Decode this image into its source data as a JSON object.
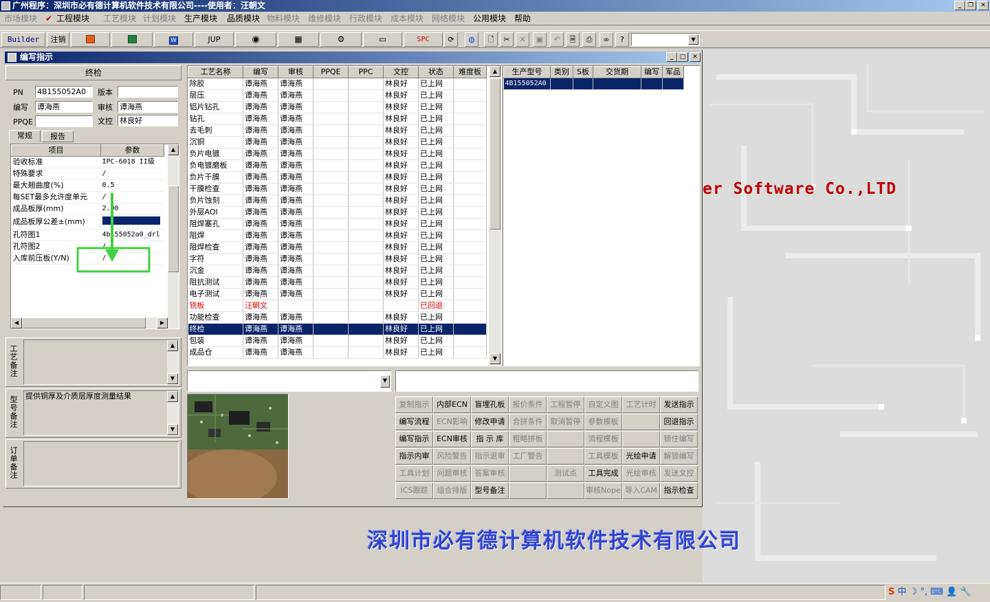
{
  "app": {
    "title": "广州程序：深圳市必有德计算机软件技术有限公司----使用者：汪朝文"
  },
  "menu": [
    {
      "label": "市场模块",
      "enabled": false
    },
    {
      "label": "工程模块",
      "enabled": true,
      "checked": true
    },
    {
      "label": "工艺模块",
      "enabled": false
    },
    {
      "label": "计划模块",
      "enabled": false
    },
    {
      "label": "生产模块",
      "enabled": true
    },
    {
      "label": "品质模块",
      "enabled": true
    },
    {
      "label": "物料模块",
      "enabled": false
    },
    {
      "label": "维修模块",
      "enabled": false
    },
    {
      "label": "行政模块",
      "enabled": false
    },
    {
      "label": "成本模块",
      "enabled": false
    },
    {
      "label": "网络模块",
      "enabled": false
    },
    {
      "label": "公用模块",
      "enabled": true
    },
    {
      "label": "帮助",
      "enabled": true
    }
  ],
  "toolbar": {
    "builder": "Builder",
    "logout": "注销",
    "jup": "JUP",
    "spc": "SPC",
    "combo": ""
  },
  "background": {
    "company_en": "er Software Co.,LTD",
    "company_cn": "深圳市必有德计算机软件技术有限公司"
  },
  "window": {
    "title": "编写指示"
  },
  "left": {
    "process": "终检",
    "pn_label": "PN",
    "pn": "4B155052A0",
    "version_label": "版本",
    "version": "",
    "writer_label": "编写",
    "writer": "谭海燕",
    "review_label": "审核",
    "review": "谭海燕",
    "ppqe_label": "PPQE",
    "ppqe": "",
    "doc_label": "文控",
    "doc": "林良好",
    "tabs": [
      "常规",
      "报告"
    ],
    "params_headers": [
      "项目",
      "参数"
    ],
    "params": [
      {
        "item": "验收标准",
        "value": "IPC-6018 II级"
      },
      {
        "item": "特殊要求",
        "value": "/"
      },
      {
        "item": "最大翘曲度(%)",
        "value": "0.5"
      },
      {
        "item": "每SET最多允许度单元",
        "value": "/"
      },
      {
        "item": "成品板厚(mm)",
        "value": "2.00"
      },
      {
        "item": "成品板厚公差±(mm)",
        "value": ""
      },
      {
        "item": "孔符图1",
        "value": "4b155052a0_drl"
      },
      {
        "item": "孔符图2",
        "value": "/"
      },
      {
        "item": "入库前压板(Y/N)",
        "value": "/"
      }
    ],
    "notes": [
      {
        "label": "工艺备注",
        "text": ""
      },
      {
        "label": "型号备注",
        "text": "提供铜厚及介质层厚度测量结果"
      },
      {
        "label": "订单备注",
        "text": ""
      }
    ]
  },
  "steps": {
    "headers": [
      "工艺名称",
      "编写",
      "审核",
      "PPQE",
      "PPC",
      "文控",
      "状态",
      "难度板"
    ],
    "rows": [
      [
        "除胶",
        "谭海燕",
        "谭海燕",
        "",
        "",
        "林良好",
        "已上网",
        ""
      ],
      [
        "层压",
        "谭海燕",
        "谭海燕",
        "",
        "",
        "林良好",
        "已上网",
        ""
      ],
      [
        "铝片钻孔",
        "谭海燕",
        "谭海燕",
        "",
        "",
        "林良好",
        "已上网",
        ""
      ],
      [
        "钻孔",
        "谭海燕",
        "谭海燕",
        "",
        "",
        "林良好",
        "已上网",
        ""
      ],
      [
        "去毛刺",
        "谭海燕",
        "谭海燕",
        "",
        "",
        "林良好",
        "已上网",
        ""
      ],
      [
        "沉铜",
        "谭海燕",
        "谭海燕",
        "",
        "",
        "林良好",
        "已上网",
        ""
      ],
      [
        "负片电镀",
        "谭海燕",
        "谭海燕",
        "",
        "",
        "林良好",
        "已上网",
        ""
      ],
      [
        "负电镀磨板",
        "谭海燕",
        "谭海燕",
        "",
        "",
        "林良好",
        "已上网",
        ""
      ],
      [
        "负片干膜",
        "谭海燕",
        "谭海燕",
        "",
        "",
        "林良好",
        "已上网",
        ""
      ],
      [
        "干膜检查",
        "谭海燕",
        "谭海燕",
        "",
        "",
        "林良好",
        "已上网",
        ""
      ],
      [
        "负片蚀刻",
        "谭海燕",
        "谭海燕",
        "",
        "",
        "林良好",
        "已上网",
        ""
      ],
      [
        "外层AOI",
        "谭海燕",
        "谭海燕",
        "",
        "",
        "林良好",
        "已上网",
        ""
      ],
      [
        "阻焊塞孔",
        "谭海燕",
        "谭海燕",
        "",
        "",
        "林良好",
        "已上网",
        ""
      ],
      [
        "阻焊",
        "谭海燕",
        "谭海燕",
        "",
        "",
        "林良好",
        "已上网",
        ""
      ],
      [
        "阻焊检查",
        "谭海燕",
        "谭海燕",
        "",
        "",
        "林良好",
        "已上网",
        ""
      ],
      [
        "字符",
        "谭海燕",
        "谭海燕",
        "",
        "",
        "林良好",
        "已上网",
        ""
      ],
      [
        "沉金",
        "谭海燕",
        "谭海燕",
        "",
        "",
        "林良好",
        "已上网",
        ""
      ],
      [
        "阻抗测试",
        "谭海燕",
        "谭海燕",
        "",
        "",
        "林良好",
        "已上网",
        ""
      ],
      [
        "电子测试",
        "谭海燕",
        "谭海燕",
        "",
        "",
        "林良好",
        "已上网",
        ""
      ],
      [
        "铣板",
        "汪朝文",
        "",
        "",
        "",
        "",
        "已回退",
        ""
      ],
      [
        "功能检查",
        "谭海燕",
        "谭海燕",
        "",
        "",
        "林良好",
        "已上网",
        ""
      ],
      [
        "终检",
        "谭海燕",
        "谭海燕",
        "",
        "",
        "林良好",
        "已上网",
        ""
      ],
      [
        "包装",
        "谭海燕",
        "谭海燕",
        "",
        "",
        "林良好",
        "已上网",
        ""
      ],
      [
        "成品仓",
        "谭海燕",
        "谭海燕",
        "",
        "",
        "林良好",
        "已上网",
        ""
      ]
    ],
    "selected_index": 21,
    "returned_index": 19
  },
  "orders": {
    "headers": [
      "生产型号",
      "类别",
      "S板",
      "交货期",
      "编写",
      "军品"
    ],
    "rows": [
      [
        "4B155052A0",
        "",
        "",
        "",
        "",
        ""
      ]
    ]
  },
  "actions": [
    [
      {
        "l": "复制指示",
        "e": false
      },
      {
        "l": "内部ECN",
        "e": true
      },
      {
        "l": "盲埋孔板",
        "e": true
      },
      {
        "l": "报价条件",
        "e": false
      },
      {
        "l": "工程暂停",
        "e": false
      },
      {
        "l": "自定义图",
        "e": false
      },
      {
        "l": "工艺计时",
        "e": false
      },
      {
        "l": "发送指示",
        "e": true
      }
    ],
    [
      {
        "l": "编写流程",
        "e": true
      },
      {
        "l": "ECN影响",
        "e": false
      },
      {
        "l": "修改申请",
        "e": true
      },
      {
        "l": "合拼条件",
        "e": false
      },
      {
        "l": "取消暂停",
        "e": false
      },
      {
        "l": "参数模板",
        "e": false
      },
      {
        "l": "",
        "e": false
      },
      {
        "l": "回退指示",
        "e": true
      }
    ],
    [
      {
        "l": "编写指示",
        "e": true
      },
      {
        "l": "ECN审核",
        "e": true
      },
      {
        "l": "指 示 库",
        "e": true
      },
      {
        "l": "粗略拼板",
        "e": false
      },
      {
        "l": "",
        "e": false
      },
      {
        "l": "流程模板",
        "e": false
      },
      {
        "l": "",
        "e": false
      },
      {
        "l": "锁住编写",
        "e": false
      }
    ],
    [
      {
        "l": "指示内审",
        "e": true
      },
      {
        "l": "风险警告",
        "e": false
      },
      {
        "l": "指示退审",
        "e": false
      },
      {
        "l": "工厂警告",
        "e": false
      },
      {
        "l": "",
        "e": false
      },
      {
        "l": "工具模板",
        "e": false
      },
      {
        "l": "光绘申请",
        "e": true
      },
      {
        "l": "解锁编写",
        "e": false
      }
    ],
    [
      {
        "l": "工具计划",
        "e": false
      },
      {
        "l": "问题审核",
        "e": false
      },
      {
        "l": "答案审核",
        "e": false
      },
      {
        "l": "",
        "e": false
      },
      {
        "l": "测试点",
        "e": false
      },
      {
        "l": "工具完成",
        "e": true
      },
      {
        "l": "光绘审核",
        "e": false
      },
      {
        "l": "发送文控",
        "e": false
      }
    ],
    [
      {
        "l": "ICS跟踪",
        "e": false
      },
      {
        "l": "组合排版",
        "e": false
      },
      {
        "l": "型号备注",
        "e": true
      },
      {
        "l": "",
        "e": false
      },
      {
        "l": "",
        "e": false
      },
      {
        "l": "审核Nope",
        "e": false
      },
      {
        "l": "导入CAM",
        "e": false
      },
      {
        "l": "指示检查",
        "e": true
      }
    ]
  ],
  "colors": {
    "title": "#0a246a",
    "selection": "#0a246a",
    "returned": "#e00000",
    "swatch": "#0a246a"
  }
}
